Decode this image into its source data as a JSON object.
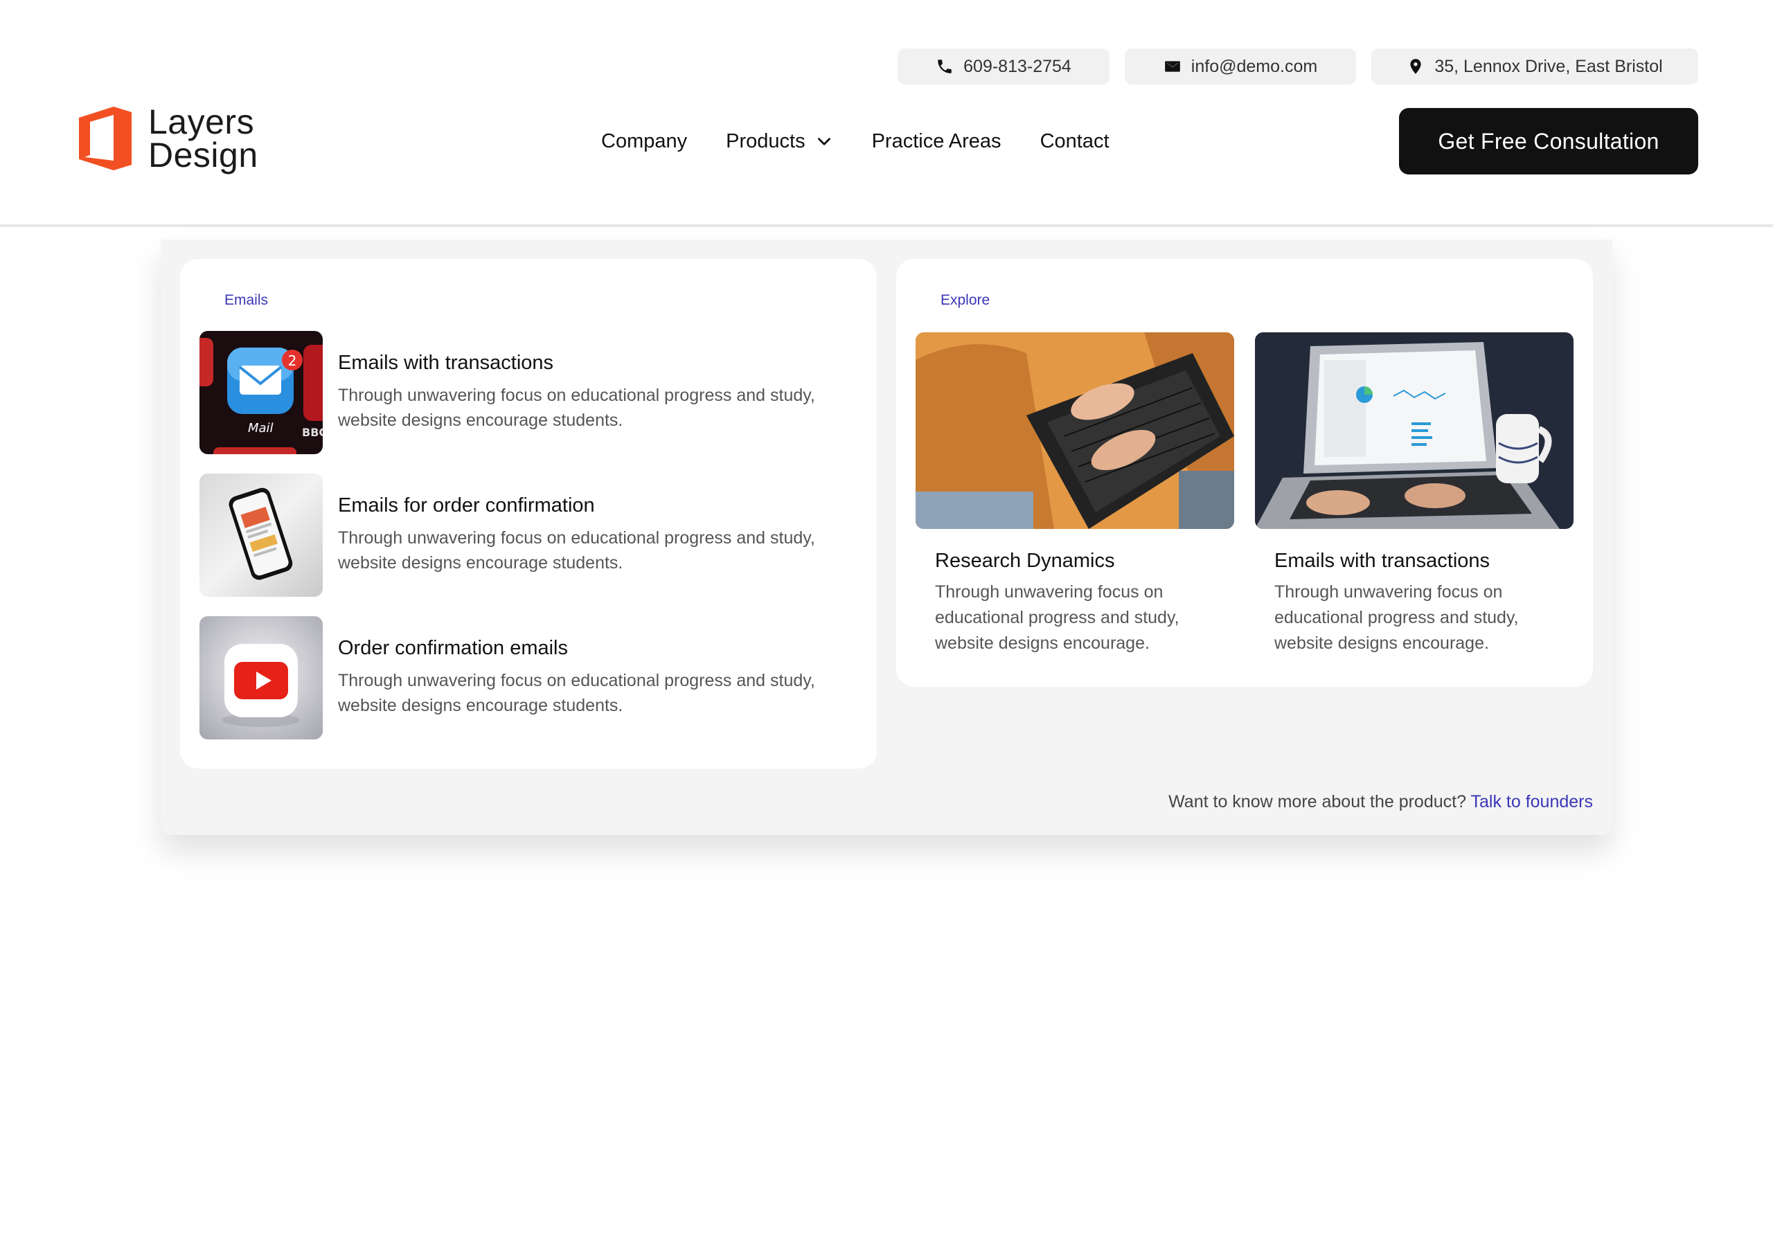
{
  "contact": {
    "phone": "609-813-2754",
    "email": "info@demo.com",
    "address": "35, Lennox Drive, East Bristol"
  },
  "brand": {
    "line1": "Layers",
    "line2": "Design",
    "accent_color": "#f25022"
  },
  "nav": {
    "items": [
      {
        "label": "Company"
      },
      {
        "label": "Products",
        "has_dropdown": true,
        "icon": "chevron-down-icon"
      },
      {
        "label": "Practice Areas"
      },
      {
        "label": "Contact"
      }
    ],
    "cta_label": "Get Free Consultation"
  },
  "menu": {
    "emails": {
      "label": "Emails",
      "items": [
        {
          "title": "Emails with transactions",
          "desc": "Through unwavering focus on educational progress and study, website designs encourage students.",
          "thumb": "mail-app-icon-photo"
        },
        {
          "title": "Emails for order confirmation",
          "desc": "Through unwavering focus on educational progress and study, website designs encourage students.",
          "thumb": "smartphone-photo"
        },
        {
          "title": "Order confirmation emails",
          "desc": "Through unwavering focus on educational progress and study, website designs encourage students.",
          "thumb": "youtube-icon-photo"
        }
      ]
    },
    "explore": {
      "label": "Explore",
      "items": [
        {
          "title": "Research Dynamics",
          "desc": "Through unwavering focus on educational progress and study, website designs encourage.",
          "image": "laptop-typing-photo"
        },
        {
          "title": "Emails with transactions",
          "desc": "Through unwavering focus on educational progress and study, website designs encourage.",
          "image": "laptop-dashboard-photo"
        }
      ]
    },
    "footer": {
      "text": "Want to know more about the product?",
      "link": "Talk to founders",
      "link_color": "#3a36b8"
    }
  }
}
